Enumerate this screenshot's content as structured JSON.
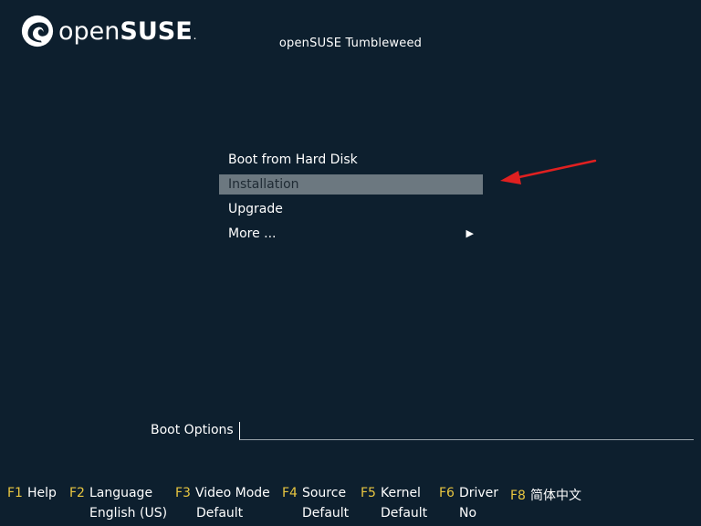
{
  "logo": {
    "text_light": "open",
    "text_bold": "SUSE",
    "text_dot": "."
  },
  "title": "openSUSE Tumbleweed",
  "menu": {
    "items": [
      {
        "label": "Boot from Hard Disk"
      },
      {
        "label": "Installation"
      },
      {
        "label": "Upgrade"
      },
      {
        "label": "More ...",
        "submenu_arrow": "▶"
      }
    ],
    "selected_index": 1
  },
  "boot_options": {
    "label": "Boot Options",
    "value": ""
  },
  "fkeys": [
    {
      "key": "F1",
      "label": "Help",
      "value": ""
    },
    {
      "key": "F2",
      "label": "Language",
      "value": "English (US)"
    },
    {
      "key": "F3",
      "label": "Video Mode",
      "value": "Default"
    },
    {
      "key": "F4",
      "label": "Source",
      "value": "Default"
    },
    {
      "key": "F5",
      "label": "Kernel",
      "value": "Default"
    },
    {
      "key": "F6",
      "label": "Driver",
      "value": "No"
    },
    {
      "key": "F8",
      "label": "简体中文",
      "value": ""
    }
  ],
  "colors": {
    "background": "#0d1f2e",
    "selection": "#6c7880",
    "fkey_accent": "#e8c640",
    "annotation": "#e02020"
  }
}
